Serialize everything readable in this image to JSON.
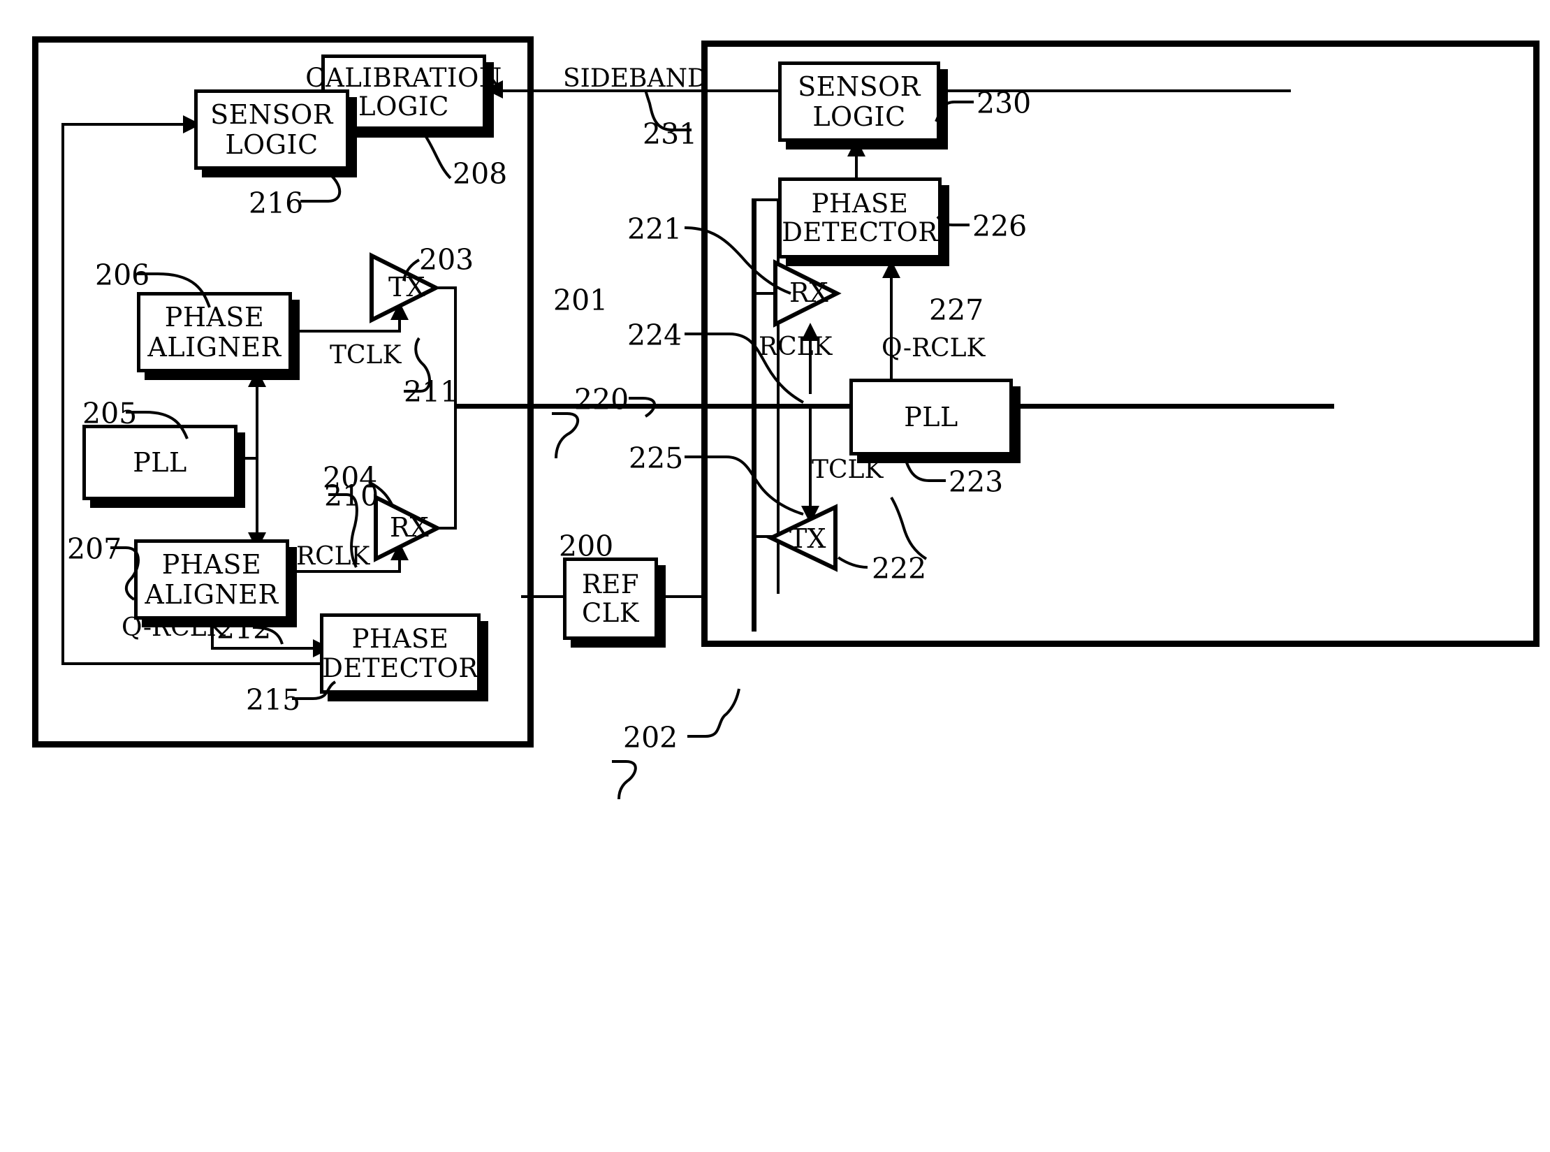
{
  "figure": {
    "type": "patent-block-diagram",
    "description": "Clock calibration block diagram with two chips linked by a bus and a sideband"
  },
  "chips": {
    "left": {
      "ref": "201"
    },
    "right": {
      "ref": "202"
    }
  },
  "blocks": {
    "calibration_logic": {
      "line1": "CALIBRATION",
      "line2": "LOGIC",
      "ref": "208"
    },
    "sensor_logic_left": {
      "line1": "SENSOR",
      "line2": "LOGIC",
      "ref": "216"
    },
    "phase_aligner_top": {
      "line1": "PHASE",
      "line2": "ALIGNER",
      "ref": "206"
    },
    "pll_left": {
      "line1": "PLL",
      "ref": "205"
    },
    "phase_aligner_bottom": {
      "line1": "PHASE",
      "line2": "ALIGNER",
      "ref": "207"
    },
    "phase_detector_left": {
      "line1": "PHASE",
      "line2": "DETECTOR",
      "ref": "215"
    },
    "ref_clk": {
      "line1": "REF",
      "line2": "CLK",
      "ref": "200"
    },
    "sensor_logic_right": {
      "line1": "SENSOR",
      "line2": "LOGIC",
      "ref": "230"
    },
    "phase_detector_right": {
      "line1": "PHASE",
      "line2": "DETECTOR",
      "ref": "226"
    },
    "pll_right": {
      "line1": "PLL",
      "ref": "223"
    }
  },
  "amplifiers": {
    "tx_left": {
      "label": "TX",
      "ref": "203"
    },
    "rx_left": {
      "label": "RX",
      "ref": "204"
    },
    "rx_right": {
      "label": "RX",
      "ref": "221"
    },
    "tx_right": {
      "label": "TX",
      "ref": "222"
    }
  },
  "signals": {
    "sideband": {
      "label": "SIDEBAND",
      "ref": "231"
    },
    "tclk_left": {
      "label": "TCLK",
      "ref": "211"
    },
    "rclk_left": {
      "label": "RCLK",
      "ref": "210"
    },
    "q_rclk_left": {
      "label": "Q-RCLK",
      "ref": "212"
    },
    "bus": {
      "ref": "220"
    },
    "rclk_right": {
      "label": "RCLK",
      "ref": "224"
    },
    "tclk_right": {
      "label": "TCLK",
      "ref": "225"
    },
    "q_rclk_right": {
      "label": "Q-RCLK",
      "ref": "227"
    }
  },
  "refs": {
    "r200": "200",
    "r201": "201",
    "r202": "202",
    "r203": "203",
    "r204": "204",
    "r205": "205",
    "r206": "206",
    "r207": "207",
    "r208": "208",
    "r210": "210",
    "r211": "211",
    "r212": "212",
    "r215": "215",
    "r216": "216",
    "r220": "220",
    "r221": "221",
    "r222": "222",
    "r223": "223",
    "r224": "224",
    "r225": "225",
    "r226": "226",
    "r227": "227",
    "r230": "230",
    "r231": "231"
  },
  "colors": {
    "ink": "#000000",
    "paper": "#ffffff"
  }
}
